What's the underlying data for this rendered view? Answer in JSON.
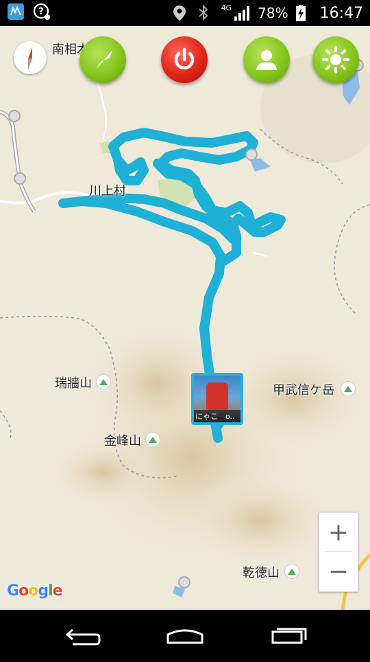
{
  "status_bar": {
    "network": "4G",
    "battery": "78%",
    "time": "16:47",
    "icons": [
      "app-notification-icon",
      "help-icon",
      "location-icon",
      "bluetooth-icon",
      "signal-icon",
      "battery-charging-icon"
    ]
  },
  "toolbar": {
    "buttons": [
      {
        "name": "navigate-button",
        "icon": "navigation-arrow-icon",
        "color": "#86c51d"
      },
      {
        "name": "power-button",
        "icon": "power-icon",
        "color": "#e02418"
      },
      {
        "name": "user-button",
        "icon": "person-icon",
        "color": "#86c51d"
      },
      {
        "name": "brightness-button",
        "icon": "sun-icon",
        "color": "#86c51d"
      }
    ]
  },
  "map": {
    "place_labels": {
      "minami_aiki": "南相木",
      "kawakami": "川上村",
      "mizugaki": "瑞牆山",
      "kinpu": "金峰山",
      "kobushi": "甲武信ケ岳",
      "kentoku": "乾徳山"
    },
    "route_color": "#1fb0d6",
    "marker": {
      "caption": "にゃこ　o.."
    },
    "zoom_in_label": "+",
    "zoom_out_label": "−",
    "attribution": {
      "letters": [
        "G",
        "o",
        "o",
        "g",
        "l",
        "e"
      ],
      "colors": [
        "#4285f4",
        "#ea4335",
        "#fbbc05",
        "#4285f4",
        "#34a853",
        "#ea4335"
      ]
    }
  },
  "nav_bar": {
    "icons": [
      "back-icon",
      "home-icon",
      "recents-icon"
    ]
  }
}
